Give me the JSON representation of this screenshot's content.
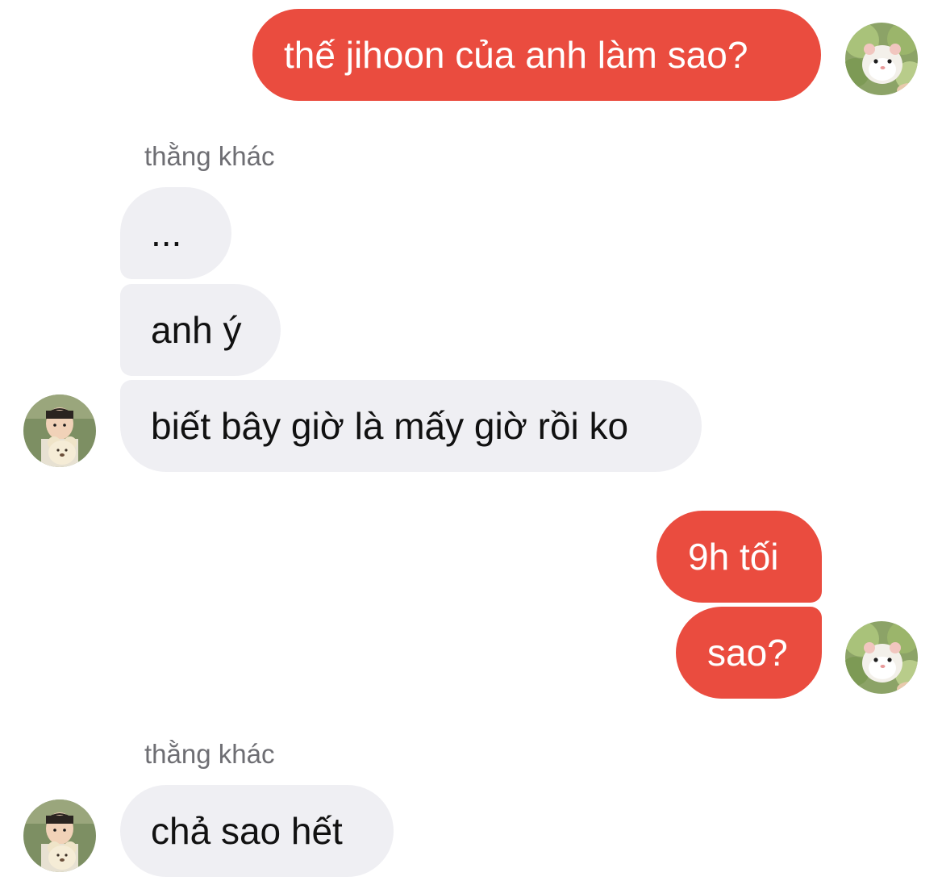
{
  "conversation": {
    "messages": [
      {
        "direction": "outgoing",
        "text": "thế jihoon của anh làm sao?"
      },
      {
        "direction": "incoming",
        "sender": "thằng khác",
        "text": "..."
      },
      {
        "direction": "incoming",
        "text": "anh ý"
      },
      {
        "direction": "incoming",
        "text": "biết bây giờ là mấy giờ rồi ko"
      },
      {
        "direction": "outgoing",
        "text": "9h tối"
      },
      {
        "direction": "outgoing",
        "text": "sao?"
      },
      {
        "direction": "incoming",
        "sender": "thằng khác",
        "text": "chả sao hết"
      }
    ],
    "avatars": {
      "self": "hamster-in-lettuce-avatar",
      "other": "child-with-teddy-bear-avatar"
    }
  },
  "colors": {
    "outgoing_bubble": "#ea4c3f",
    "incoming_bubble": "#efeff3",
    "sender_label": "#6e6e73"
  }
}
